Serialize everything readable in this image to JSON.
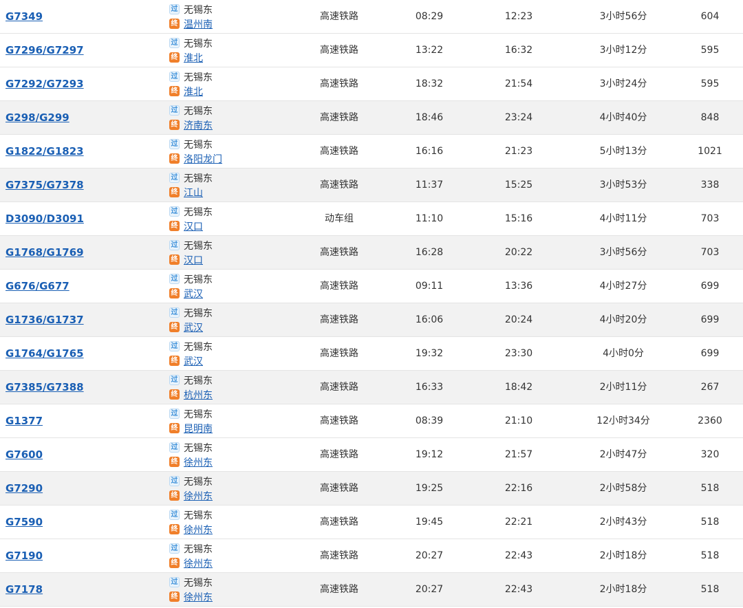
{
  "badges": {
    "pass": "过",
    "end": "终"
  },
  "colors": {
    "link": "#1a5fb4",
    "end_badge": "#f07f2a",
    "pass_badge": "#3b8fd9",
    "row_alt": "#f2f2f2"
  },
  "rows": [
    {
      "train": "G7349",
      "from": "无锡东",
      "to": "温州南",
      "type": "高速铁路",
      "dep": "08:29",
      "arr": "12:23",
      "dur": "3小时56分",
      "dist": "604"
    },
    {
      "train": "G7296/G7297",
      "from": "无锡东",
      "to": "淮北",
      "type": "高速铁路",
      "dep": "13:22",
      "arr": "16:32",
      "dur": "3小时12分",
      "dist": "595"
    },
    {
      "train": "G7292/G7293",
      "from": "无锡东",
      "to": "淮北",
      "type": "高速铁路",
      "dep": "18:32",
      "arr": "21:54",
      "dur": "3小时24分",
      "dist": "595"
    },
    {
      "train": "G298/G299",
      "from": "无锡东",
      "to": "济南东",
      "type": "高速铁路",
      "dep": "18:46",
      "arr": "23:24",
      "dur": "4小时40分",
      "dist": "848"
    },
    {
      "train": "G1822/G1823",
      "from": "无锡东",
      "to": "洛阳龙门",
      "type": "高速铁路",
      "dep": "16:16",
      "arr": "21:23",
      "dur": "5小时13分",
      "dist": "1021"
    },
    {
      "train": "G7375/G7378",
      "from": "无锡东",
      "to": "江山",
      "type": "高速铁路",
      "dep": "11:37",
      "arr": "15:25",
      "dur": "3小时53分",
      "dist": "338"
    },
    {
      "train": "D3090/D3091",
      "from": "无锡东",
      "to": "汉口",
      "type": "动车组",
      "dep": "11:10",
      "arr": "15:16",
      "dur": "4小时11分",
      "dist": "703"
    },
    {
      "train": "G1768/G1769",
      "from": "无锡东",
      "to": "汉口",
      "type": "高速铁路",
      "dep": "16:28",
      "arr": "20:22",
      "dur": "3小时56分",
      "dist": "703"
    },
    {
      "train": "G676/G677",
      "from": "无锡东",
      "to": "武汉",
      "type": "高速铁路",
      "dep": "09:11",
      "arr": "13:36",
      "dur": "4小时27分",
      "dist": "699"
    },
    {
      "train": "G1736/G1737",
      "from": "无锡东",
      "to": "武汉",
      "type": "高速铁路",
      "dep": "16:06",
      "arr": "20:24",
      "dur": "4小时20分",
      "dist": "699"
    },
    {
      "train": "G1764/G1765",
      "from": "无锡东",
      "to": "武汉",
      "type": "高速铁路",
      "dep": "19:32",
      "arr": "23:30",
      "dur": "4小时0分",
      "dist": "699"
    },
    {
      "train": "G7385/G7388",
      "from": "无锡东",
      "to": "杭州东",
      "type": "高速铁路",
      "dep": "16:33",
      "arr": "18:42",
      "dur": "2小时11分",
      "dist": "267"
    },
    {
      "train": "G1377",
      "from": "无锡东",
      "to": "昆明南",
      "type": "高速铁路",
      "dep": "08:39",
      "arr": "21:10",
      "dur": "12小时34分",
      "dist": "2360"
    },
    {
      "train": "G7600",
      "from": "无锡东",
      "to": "徐州东",
      "type": "高速铁路",
      "dep": "19:12",
      "arr": "21:57",
      "dur": "2小时47分",
      "dist": "320"
    },
    {
      "train": "G7290",
      "from": "无锡东",
      "to": "徐州东",
      "type": "高速铁路",
      "dep": "19:25",
      "arr": "22:16",
      "dur": "2小时58分",
      "dist": "518"
    },
    {
      "train": "G7590",
      "from": "无锡东",
      "to": "徐州东",
      "type": "高速铁路",
      "dep": "19:45",
      "arr": "22:21",
      "dur": "2小时43分",
      "dist": "518"
    },
    {
      "train": "G7190",
      "from": "无锡东",
      "to": "徐州东",
      "type": "高速铁路",
      "dep": "20:27",
      "arr": "22:43",
      "dur": "2小时18分",
      "dist": "518"
    },
    {
      "train": "G7178",
      "from": "无锡东",
      "to": "徐州东",
      "type": "高速铁路",
      "dep": "20:27",
      "arr": "22:43",
      "dur": "2小时18分",
      "dist": "518"
    }
  ]
}
